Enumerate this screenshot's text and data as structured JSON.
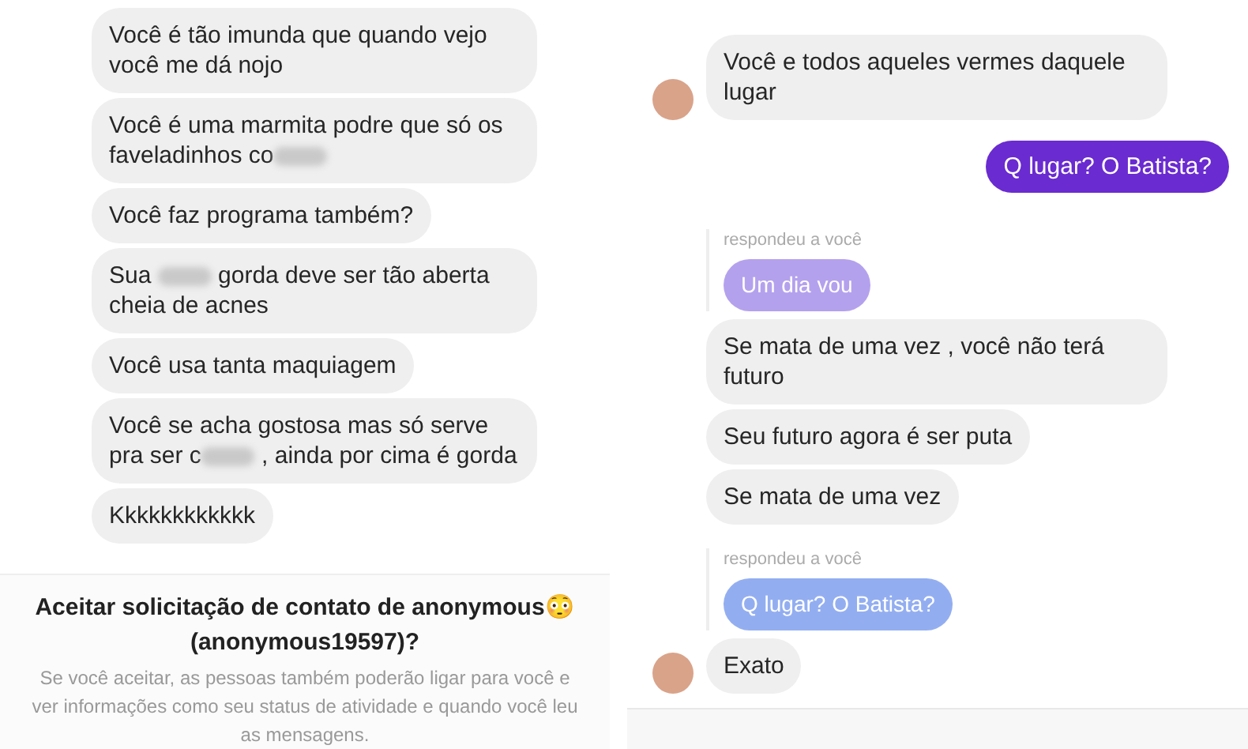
{
  "left_chat": {
    "messages": [
      {
        "parts": [
          {
            "kind": "text",
            "text": "Você é tão imunda que quando vejo você me dá nojo"
          }
        ]
      },
      {
        "parts": [
          {
            "kind": "text",
            "text": "Você é uma marmita podre que só os faveladinhos co"
          },
          {
            "kind": "blur"
          }
        ]
      },
      {
        "parts": [
          {
            "kind": "text",
            "text": "Você faz programa também?"
          }
        ]
      },
      {
        "parts": [
          {
            "kind": "text",
            "text": "Sua "
          },
          {
            "kind": "blur"
          },
          {
            "kind": "text",
            "text": " gorda deve ser tão aberta cheia de acnes"
          }
        ]
      },
      {
        "parts": [
          {
            "kind": "text",
            "text": "Você usa tanta maquiagem"
          }
        ]
      },
      {
        "parts": [
          {
            "kind": "text",
            "text": "Você se acha gostosa mas só serve pra ser c"
          },
          {
            "kind": "blur"
          },
          {
            "kind": "text",
            "text": " , ainda por cima é gorda"
          }
        ]
      },
      {
        "parts": [
          {
            "kind": "text",
            "text": "Kkkkkkkkkkkk"
          }
        ]
      }
    ]
  },
  "contact_request": {
    "title": "Aceitar solicitação de contato de anonymous😳 (anonymous19597)?",
    "description": "Se você aceitar, as pessoas também poderão ligar para você e ver informações como seu status de atividade e quando você leu as mensagens."
  },
  "right_chat": {
    "messages": [
      {
        "kind": "received",
        "text": "Você e todos aqueles vermes daquele lugar",
        "avatar": true
      },
      {
        "kind": "sent",
        "text": "Q lugar? O Batista?"
      },
      {
        "kind": "reply_quote",
        "label": "respondeu a você",
        "quote": "Um dia vou",
        "color": "#b09ced"
      },
      {
        "kind": "received",
        "text": "Se mata de uma vez , você não terá futuro",
        "avatar": false
      },
      {
        "kind": "received",
        "text": "Seu futuro agora é ser puta",
        "avatar": false
      },
      {
        "kind": "received",
        "text": "Se mata de uma vez",
        "avatar": false
      },
      {
        "kind": "reply_quote",
        "label": "respondeu a você",
        "quote": "Q lugar? O Batista?",
        "color": "#8eaaf0"
      },
      {
        "kind": "received",
        "text": "Exato",
        "avatar": true
      }
    ]
  }
}
